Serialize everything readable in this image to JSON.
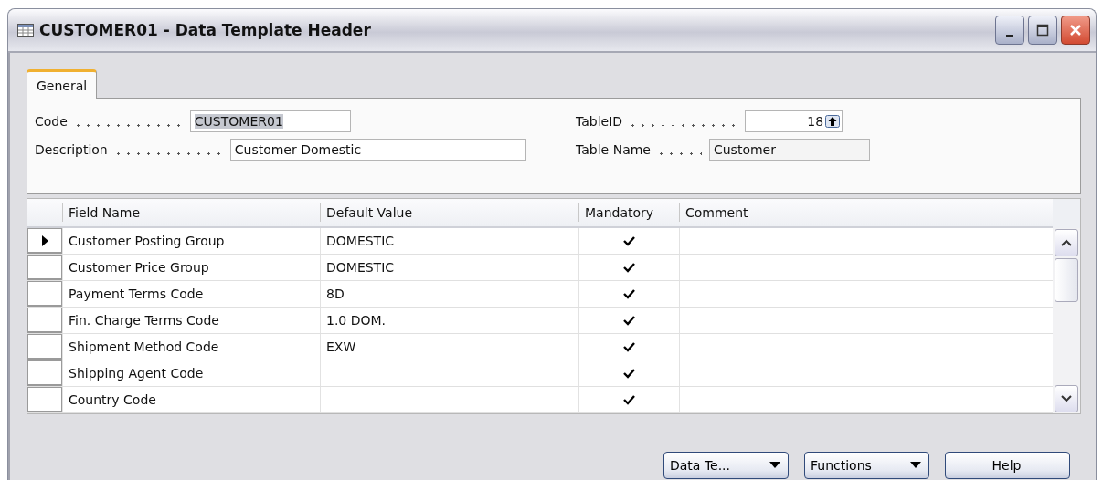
{
  "window": {
    "title": "CUSTOMER01 - Data Template Header"
  },
  "tabs": [
    {
      "label": "General",
      "selected": true
    }
  ],
  "form": {
    "left": [
      {
        "label": "Code",
        "value": "CUSTOMER01",
        "kind": "highlighted"
      },
      {
        "label": "Description",
        "value": "Customer Domestic",
        "kind": "text"
      }
    ],
    "right": [
      {
        "label": "TableID",
        "value": "18",
        "kind": "lookup"
      },
      {
        "label": "Table Name",
        "value": "Customer",
        "kind": "readonly"
      }
    ]
  },
  "table": {
    "columns": [
      "Field Name",
      "Default Value",
      "Mandatory",
      "Comment"
    ],
    "rows": [
      {
        "field_name": "Customer Posting Group",
        "default_value": "DOMESTIC",
        "mandatory": true,
        "selected": true
      },
      {
        "field_name": "Customer Price Group",
        "default_value": "DOMESTIC",
        "mandatory": true,
        "selected": false
      },
      {
        "field_name": "Payment Terms Code",
        "default_value": "8D",
        "mandatory": true,
        "selected": false
      },
      {
        "field_name": "Fin. Charge Terms Code",
        "default_value": "1.0 DOM.",
        "mandatory": true,
        "selected": false
      },
      {
        "field_name": "Shipment Method Code",
        "default_value": "EXW",
        "mandatory": true,
        "selected": false
      },
      {
        "field_name": "Shipping Agent Code",
        "mandatory": true,
        "selected": false
      },
      {
        "field_name": "Country Code",
        "mandatory": true,
        "selected": false
      }
    ]
  },
  "buttons": [
    {
      "label": "Data Te...",
      "kind": "menu"
    },
    {
      "label": "Functions",
      "kind": "menu"
    },
    {
      "label": "Help",
      "kind": "plain"
    }
  ]
}
